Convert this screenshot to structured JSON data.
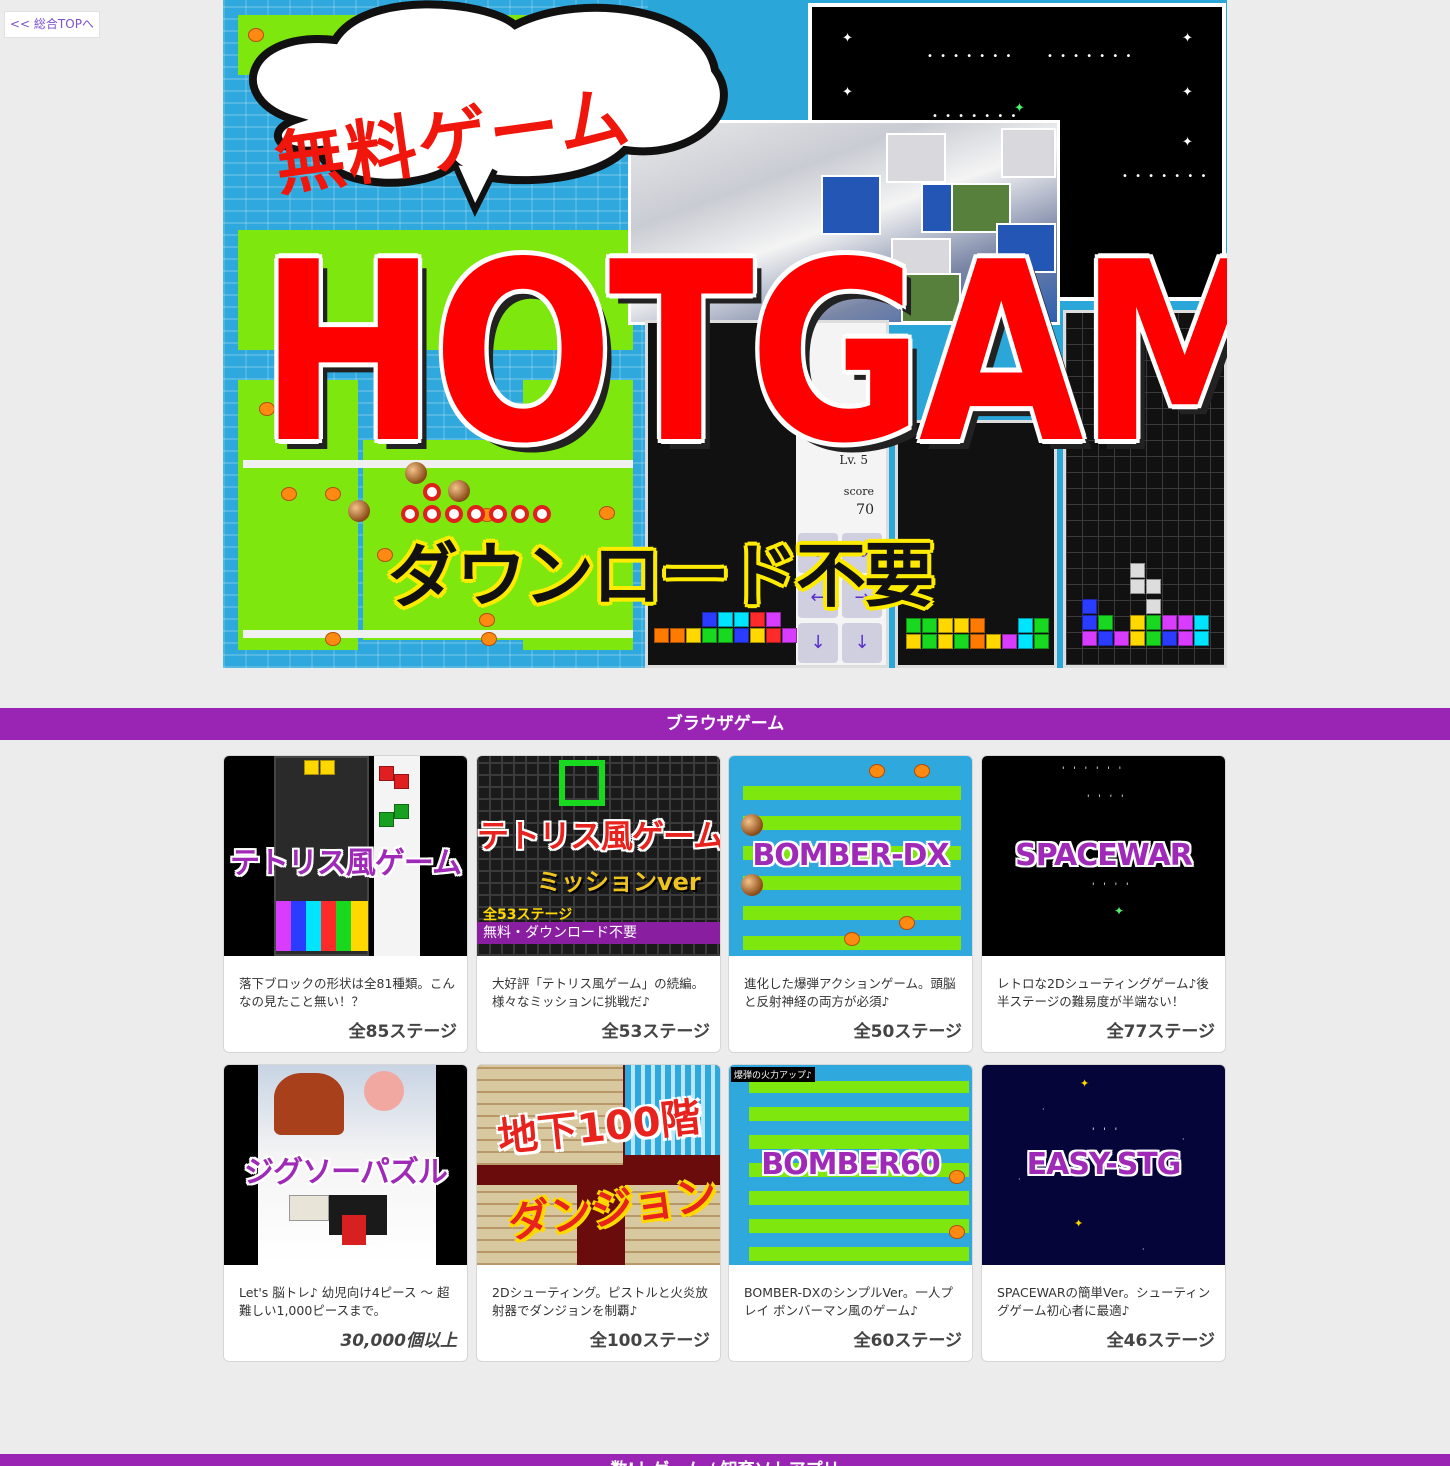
{
  "nav": {
    "top_link": "<< 総合TOPへ"
  },
  "hero": {
    "subtitle": "無料ゲーム",
    "title": "HOTGAME",
    "tagline": "ダウンロード不要",
    "level_label": "Lv. 5",
    "score_label": "score",
    "score_value": "70"
  },
  "sections": {
    "browser": "ブラウザゲーム",
    "bottom": "数!トゲーム / 知育ソトアプリ"
  },
  "games": [
    {
      "title": "テトリス風ゲーム",
      "desc": "落下ブロックの形状は全81種類。こんなの見たこと無い！？",
      "count": "全85ステージ"
    },
    {
      "title": "テトリス風ゲーム",
      "subtitle": "ミッションver",
      "badge1": "全53ステージ",
      "badge2": "無料・ダウンロード不要",
      "desc": "大好評「テトリス風ゲーム」の続編。様々なミッションに挑戦だ♪",
      "count": "全53ステージ"
    },
    {
      "title": "BOMBER-DX",
      "desc": "進化した爆弾アクションゲーム。頭脳と反射神経の両方が必須♪",
      "count": "全50ステージ"
    },
    {
      "title": "SPACEWAR",
      "desc": "レトロな2Dシューティングゲーム♪後半ステージの難易度が半端ない！",
      "count": "全77ステージ"
    },
    {
      "title": "ジグソーパズル",
      "desc": "Let's 脳トレ♪ 幼児向け4ピース ～ 超難しい1,000ピースまで。",
      "count": "30,000個以上"
    },
    {
      "title": "地下100階",
      "subtitle": "ダンジョン",
      "desc": "2Dシューティング。ピストルと火炎放射器でダンジョンを制覇♪",
      "count": "全100ステージ"
    },
    {
      "title": "BOMBER60",
      "caption": "爆弾の火力アップ♪",
      "desc": "BOMBER-DXのシンプルVer。一人プレイ ボンバーマン風のゲーム♪",
      "count": "全60ステージ"
    },
    {
      "title": "EASY-STG",
      "desc": "SPACEWARの簡単Ver。シューティングゲーム初心者に最適♪",
      "count": "全46ステージ"
    }
  ],
  "colors": {
    "accent": "#9a24b4",
    "hero_red": "#ff0000",
    "link": "#7a4fd0"
  }
}
